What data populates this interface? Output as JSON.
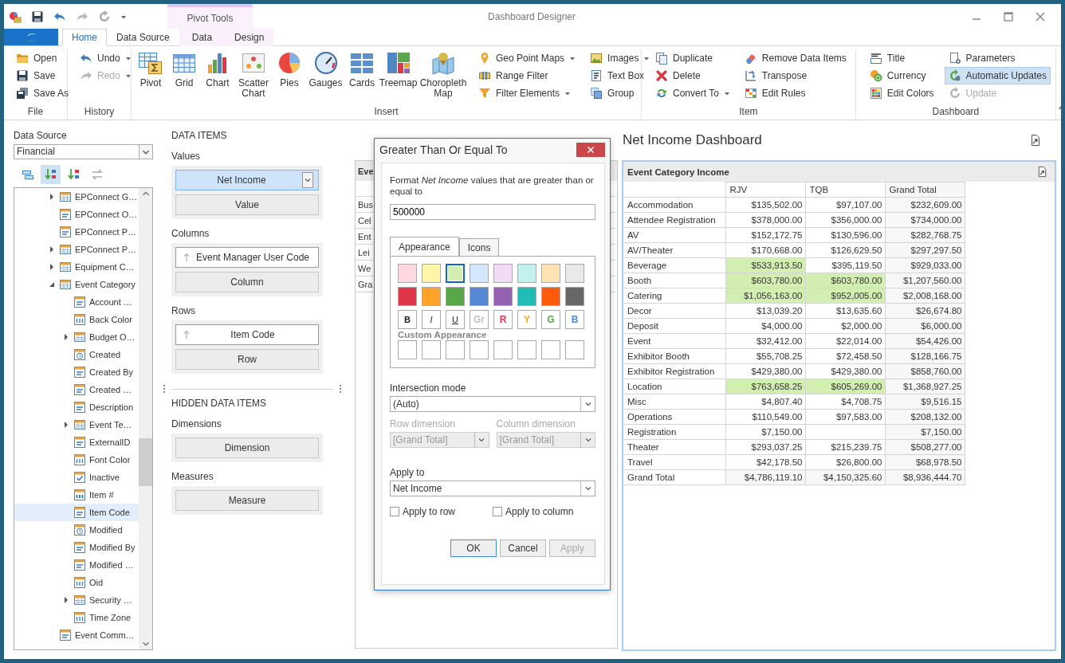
{
  "window": {
    "title": "Dashboard Designer",
    "context_title": "Pivot Tools"
  },
  "ribbon_tabs": [
    {
      "label": "Home",
      "selected": true,
      "contextual": false
    },
    {
      "label": "Data Source",
      "selected": false,
      "contextual": false
    },
    {
      "label": "Data",
      "selected": false,
      "contextual": true
    },
    {
      "label": "Design",
      "selected": false,
      "contextual": true
    }
  ],
  "ribbon_groups": [
    {
      "label": "File",
      "columns": [
        [
          {
            "label": "Open",
            "dropdown": false,
            "disabled": false,
            "on": false
          },
          {
            "label": "Save",
            "dropdown": false,
            "disabled": false,
            "on": false
          },
          {
            "label": "Save As",
            "dropdown": false,
            "disabled": false,
            "on": false
          }
        ]
      ]
    },
    {
      "label": "History",
      "columns": [
        [
          {
            "label": "Undo",
            "dropdown": true,
            "disabled": false,
            "on": false
          },
          {
            "label": "Redo",
            "dropdown": true,
            "disabled": true,
            "on": false
          }
        ]
      ]
    },
    {
      "label": "Insert",
      "large": [
        {
          "label": "Pivot"
        },
        {
          "label": "Grid"
        },
        {
          "label": "Chart"
        },
        {
          "label": "Scatter Chart"
        },
        {
          "label": "Pies"
        },
        {
          "label": "Gauges"
        },
        {
          "label": "Cards"
        },
        {
          "label": "Treemap"
        },
        {
          "label": "Choropleth Map"
        }
      ],
      "columns": [
        [
          {
            "label": "Geo Point Maps",
            "dropdown": true,
            "disabled": false,
            "on": false
          },
          {
            "label": "Range Filter",
            "dropdown": false,
            "disabled": false,
            "on": false
          },
          {
            "label": "Filter Elements",
            "dropdown": true,
            "disabled": false,
            "on": false
          }
        ],
        [
          {
            "label": "Images",
            "dropdown": true,
            "disabled": false,
            "on": false
          },
          {
            "label": "Text Box",
            "dropdown": false,
            "disabled": false,
            "on": false
          },
          {
            "label": "Group",
            "dropdown": false,
            "disabled": false,
            "on": false
          }
        ]
      ]
    },
    {
      "label": "Item",
      "columns": [
        [
          {
            "label": "Duplicate",
            "dropdown": false,
            "disabled": false,
            "on": false
          },
          {
            "label": "Delete",
            "dropdown": false,
            "disabled": false,
            "on": false
          },
          {
            "label": "Convert To",
            "dropdown": true,
            "disabled": false,
            "on": false
          }
        ],
        [
          {
            "label": "Remove Data Items",
            "dropdown": false,
            "disabled": false,
            "on": false
          },
          {
            "label": "Transpose",
            "dropdown": false,
            "disabled": false,
            "on": false
          },
          {
            "label": "Edit Rules",
            "dropdown": false,
            "disabled": false,
            "on": false
          }
        ]
      ]
    },
    {
      "label": "Dashboard",
      "columns": [
        [
          {
            "label": "Title",
            "dropdown": false,
            "disabled": false,
            "on": false
          },
          {
            "label": "Currency",
            "dropdown": false,
            "disabled": false,
            "on": false
          },
          {
            "label": "Edit Colors",
            "dropdown": false,
            "disabled": false,
            "on": false
          }
        ],
        [
          {
            "label": "Parameters",
            "dropdown": false,
            "disabled": false,
            "on": false
          },
          {
            "label": "Automatic Updates",
            "dropdown": false,
            "disabled": false,
            "on": true
          },
          {
            "label": "Update",
            "dropdown": false,
            "disabled": true,
            "on": false
          }
        ]
      ]
    }
  ],
  "data_source": {
    "label": "Data Source",
    "value": "Financial",
    "tools": [
      {
        "selected": false
      },
      {
        "selected": true
      },
      {
        "selected": false
      },
      {
        "selected": false
      }
    ],
    "tree": [
      {
        "label": "EPConnect G…",
        "kind": "table",
        "expanded": false,
        "selected": false
      },
      {
        "label": "EPConnect O…",
        "kind": "text",
        "selected": false
      },
      {
        "label": "EPConnect P…",
        "kind": "text",
        "selected": false
      },
      {
        "label": "EPConnect P…",
        "kind": "table",
        "expanded": false,
        "selected": false
      },
      {
        "label": "Equipment C…",
        "kind": "table",
        "expanded": false,
        "selected": false
      },
      {
        "label": "Event Category",
        "kind": "table",
        "expanded": true,
        "selected": false,
        "children": [
          {
            "label": "Account …",
            "kind": "text",
            "selected": false
          },
          {
            "label": "Back Color",
            "kind": "number",
            "selected": false
          },
          {
            "label": "Budget O…",
            "kind": "table",
            "expanded": false,
            "selected": false
          },
          {
            "label": "Created",
            "kind": "date",
            "selected": false
          },
          {
            "label": "Created By",
            "kind": "text",
            "selected": false
          },
          {
            "label": "Created …",
            "kind": "text",
            "selected": false
          },
          {
            "label": "Description",
            "kind": "text",
            "selected": false
          },
          {
            "label": "Event Te…",
            "kind": "table",
            "expanded": false,
            "selected": false
          },
          {
            "label": "ExternalID",
            "kind": "text",
            "selected": false
          },
          {
            "label": "Font Color",
            "kind": "number",
            "selected": false
          },
          {
            "label": "Inactive",
            "kind": "bool",
            "selected": false
          },
          {
            "label": "Item #",
            "kind": "integer",
            "selected": false
          },
          {
            "label": "Item Code",
            "kind": "text",
            "selected": true
          },
          {
            "label": "Modified",
            "kind": "date",
            "selected": false
          },
          {
            "label": "Modified By",
            "kind": "text",
            "selected": false
          },
          {
            "label": "Modified …",
            "kind": "text",
            "selected": false
          },
          {
            "label": "Oid",
            "kind": "number",
            "selected": false
          },
          {
            "label": "Security …",
            "kind": "table",
            "expanded": false,
            "selected": false
          },
          {
            "label": "Time Zone",
            "kind": "number",
            "selected": false
          }
        ]
      },
      {
        "label": "Event Comm…",
        "kind": "text",
        "selected": false
      }
    ]
  },
  "data_items": {
    "title": "DATA ITEMS",
    "sections": [
      {
        "label": "Values",
        "items": [
          {
            "label": "Net Income",
            "kind": "measure",
            "selected": true
          },
          {
            "label": "Value",
            "kind": "placeholder",
            "selected": false
          }
        ]
      },
      {
        "label": "Columns",
        "items": [
          {
            "label": "Event Manager User Code",
            "kind": "dimension",
            "selected": false
          },
          {
            "label": "Column",
            "kind": "placeholder",
            "selected": false
          }
        ]
      },
      {
        "label": "Rows",
        "items": [
          {
            "label": "Item Code",
            "kind": "dimension",
            "selected": false
          },
          {
            "label": "Row",
            "kind": "placeholder",
            "selected": false
          }
        ]
      }
    ],
    "hidden_title": "HIDDEN DATA ITEMS",
    "hidden_sections": [
      {
        "label": "Dimensions",
        "items": [
          {
            "label": "Dimension",
            "kind": "placeholder",
            "selected": false
          }
        ]
      },
      {
        "label": "Measures",
        "items": [
          {
            "label": "Measure",
            "kind": "placeholder",
            "selected": false
          }
        ]
      }
    ]
  },
  "background_item": {
    "title": "Eve",
    "rows": [
      "Bus",
      "Cel",
      "Ent",
      "Lei",
      "We",
      "Gra"
    ]
  },
  "dashboard": {
    "title": "Net Income Dashboard",
    "pivot": {
      "title": "Event Category Income",
      "columns": [
        "RJV",
        "TQB",
        "Grand Total"
      ],
      "rows": [
        {
          "label": "Accommodation",
          "cells": [
            {
              "value": "$135,502.00",
              "highlighted": false
            },
            {
              "value": "$97,107.00",
              "highlighted": false
            },
            {
              "value": "$232,609.00",
              "highlighted": false
            }
          ]
        },
        {
          "label": "Attendee Registration",
          "cells": [
            {
              "value": "$378,000.00",
              "highlighted": false
            },
            {
              "value": "$356,000.00",
              "highlighted": false
            },
            {
              "value": "$734,000.00",
              "highlighted": false
            }
          ]
        },
        {
          "label": "AV",
          "cells": [
            {
              "value": "$152,172.75",
              "highlighted": false
            },
            {
              "value": "$130,596.00",
              "highlighted": false
            },
            {
              "value": "$282,768.75",
              "highlighted": false
            }
          ]
        },
        {
          "label": "AV/Theater",
          "cells": [
            {
              "value": "$170,668.00",
              "highlighted": false
            },
            {
              "value": "$126,629.50",
              "highlighted": false
            },
            {
              "value": "$297,297.50",
              "highlighted": false
            }
          ]
        },
        {
          "label": "Beverage",
          "cells": [
            {
              "value": "$533,913.50",
              "highlighted": true
            },
            {
              "value": "$395,119.50",
              "highlighted": false
            },
            {
              "value": "$929,033.00",
              "highlighted": false
            }
          ]
        },
        {
          "label": "Booth",
          "cells": [
            {
              "value": "$603,780.00",
              "highlighted": true
            },
            {
              "value": "$603,780.00",
              "highlighted": true
            },
            {
              "value": "$1,207,560.00",
              "highlighted": false
            }
          ]
        },
        {
          "label": "Catering",
          "cells": [
            {
              "value": "$1,056,163.00",
              "highlighted": true
            },
            {
              "value": "$952,005.00",
              "highlighted": true
            },
            {
              "value": "$2,008,168.00",
              "highlighted": false
            }
          ]
        },
        {
          "label": "Decor",
          "cells": [
            {
              "value": "$13,039.20",
              "highlighted": false
            },
            {
              "value": "$13,635.60",
              "highlighted": false
            },
            {
              "value": "$26,674.80",
              "highlighted": false
            }
          ]
        },
        {
          "label": "Deposit",
          "cells": [
            {
              "value": "$4,000.00",
              "highlighted": false
            },
            {
              "value": "$2,000.00",
              "highlighted": false
            },
            {
              "value": "$6,000.00",
              "highlighted": false
            }
          ]
        },
        {
          "label": "Event",
          "cells": [
            {
              "value": "$32,412.00",
              "highlighted": false
            },
            {
              "value": "$22,014.00",
              "highlighted": false
            },
            {
              "value": "$54,426.00",
              "highlighted": false
            }
          ]
        },
        {
          "label": "Exhibitor Booth",
          "cells": [
            {
              "value": "$55,708.25",
              "highlighted": false
            },
            {
              "value": "$72,458.50",
              "highlighted": false
            },
            {
              "value": "$128,166.75",
              "highlighted": false
            }
          ]
        },
        {
          "label": "Exhibitor Registration",
          "cells": [
            {
              "value": "$429,380.00",
              "highlighted": false
            },
            {
              "value": "$429,380.00",
              "highlighted": false
            },
            {
              "value": "$858,760.00",
              "highlighted": false
            }
          ]
        },
        {
          "label": "Location",
          "cells": [
            {
              "value": "$763,658.25",
              "highlighted": true
            },
            {
              "value": "$605,269.00",
              "highlighted": true
            },
            {
              "value": "$1,368,927.25",
              "highlighted": false
            }
          ]
        },
        {
          "label": "Misc",
          "cells": [
            {
              "value": "$4,807.40",
              "highlighted": false
            },
            {
              "value": "$4,708.75",
              "highlighted": false
            },
            {
              "value": "$9,516.15",
              "highlighted": false
            }
          ]
        },
        {
          "label": "Operations",
          "cells": [
            {
              "value": "$110,549.00",
              "highlighted": false
            },
            {
              "value": "$97,583.00",
              "highlighted": false
            },
            {
              "value": "$208,132.00",
              "highlighted": false
            }
          ]
        },
        {
          "label": "Registration",
          "cells": [
            {
              "value": "$7,150.00",
              "highlighted": false
            },
            {
              "highlighted": false
            },
            {
              "value": "$7,150.00",
              "highlighted": false
            }
          ]
        },
        {
          "label": "Theater",
          "cells": [
            {
              "value": "$293,037.25",
              "highlighted": false
            },
            {
              "value": "$215,239.75",
              "highlighted": false
            },
            {
              "value": "$508,277.00",
              "highlighted": false
            }
          ]
        },
        {
          "label": "Travel",
          "cells": [
            {
              "value": "$42,178.50",
              "highlighted": false
            },
            {
              "value": "$26,800.00",
              "highlighted": false
            },
            {
              "value": "$68,978.50",
              "highlighted": false
            }
          ]
        },
        {
          "label": "Grand Total",
          "cells": [
            {
              "value": "$4,786,119.10",
              "highlighted": false
            },
            {
              "value": "$4,150,325.60",
              "highlighted": false
            },
            {
              "value": "$8,936,444.70",
              "highlighted": false
            }
          ]
        }
      ]
    }
  },
  "dialog": {
    "title": "Greater Than Or Equal To",
    "description": "Format *Net Income* values that are greater than or equal to",
    "value": "500000",
    "tabs": [
      {
        "label": "Appearance",
        "selected": true
      },
      {
        "label": "Icons",
        "selected": false
      }
    ],
    "swatches": [
      {
        "kind": "fill",
        "color": "#ffd9e0",
        "selected": false
      },
      {
        "kind": "fill",
        "color": "#fff5a8",
        "selected": false
      },
      {
        "kind": "fill",
        "color": "#d2eeb0",
        "selected": true
      },
      {
        "kind": "fill",
        "color": "#d5e8fb",
        "selected": false
      },
      {
        "kind": "fill",
        "color": "#f1dcf5",
        "selected": false
      },
      {
        "kind": "fill",
        "color": "#c4f1ee",
        "selected": false
      },
      {
        "kind": "fill",
        "color": "#ffe3b2",
        "selected": false
      },
      {
        "kind": "fill",
        "color": "#e9e9e9",
        "selected": false
      },
      {
        "kind": "fill",
        "color": "#e0364a",
        "selected": false
      },
      {
        "kind": "fill",
        "color": "#fea22a",
        "selected": false
      },
      {
        "kind": "fill",
        "color": "#5aa64a",
        "selected": false
      },
      {
        "kind": "fill",
        "color": "#5589d5",
        "selected": false
      },
      {
        "kind": "fill",
        "color": "#9461b3",
        "selected": false
      },
      {
        "kind": "fill",
        "color": "#21bcb6",
        "selected": false
      },
      {
        "kind": "fill",
        "color": "#fd5a0c",
        "selected": false
      },
      {
        "kind": "fill",
        "color": "#676767",
        "selected": false
      },
      {
        "kind": "bold",
        "label": "B",
        "selected": false
      },
      {
        "kind": "italic",
        "label": "I",
        "selected": false
      },
      {
        "kind": "underline",
        "label": "U",
        "selected": false
      },
      {
        "kind": "font",
        "label": "Gr",
        "color": "#c0c0c0",
        "selected": false
      },
      {
        "kind": "font",
        "label": "R",
        "color": "#e0364a",
        "selected": false
      },
      {
        "kind": "font",
        "label": "Y",
        "color": "#fea22a",
        "selected": false
      },
      {
        "kind": "font",
        "label": "G",
        "color": "#5aa64a",
        "selected": false
      },
      {
        "kind": "font",
        "label": "B",
        "color": "#5589d5",
        "selected": false
      }
    ],
    "custom_title": "Custom Appearance",
    "intersection": {
      "label": "Intersection mode",
      "value": "(Auto)",
      "disabled": false
    },
    "row_dimension": {
      "label": "Row dimension",
      "value": "[Grand Total]",
      "disabled": true
    },
    "column_dimension": {
      "label": "Column dimension",
      "value": "[Grand Total]",
      "disabled": true
    },
    "apply_to": {
      "label": "Apply to",
      "value": "Net Income",
      "disabled": false
    },
    "checkboxes": [
      {
        "label": "Apply to row",
        "checked": false
      },
      {
        "label": "Apply to column",
        "checked": false
      }
    ],
    "buttons": [
      {
        "label": "OK",
        "default": true,
        "disabled": false
      },
      {
        "label": "Cancel",
        "default": false,
        "disabled": false
      },
      {
        "label": "Apply",
        "default": false,
        "disabled": true
      }
    ]
  }
}
